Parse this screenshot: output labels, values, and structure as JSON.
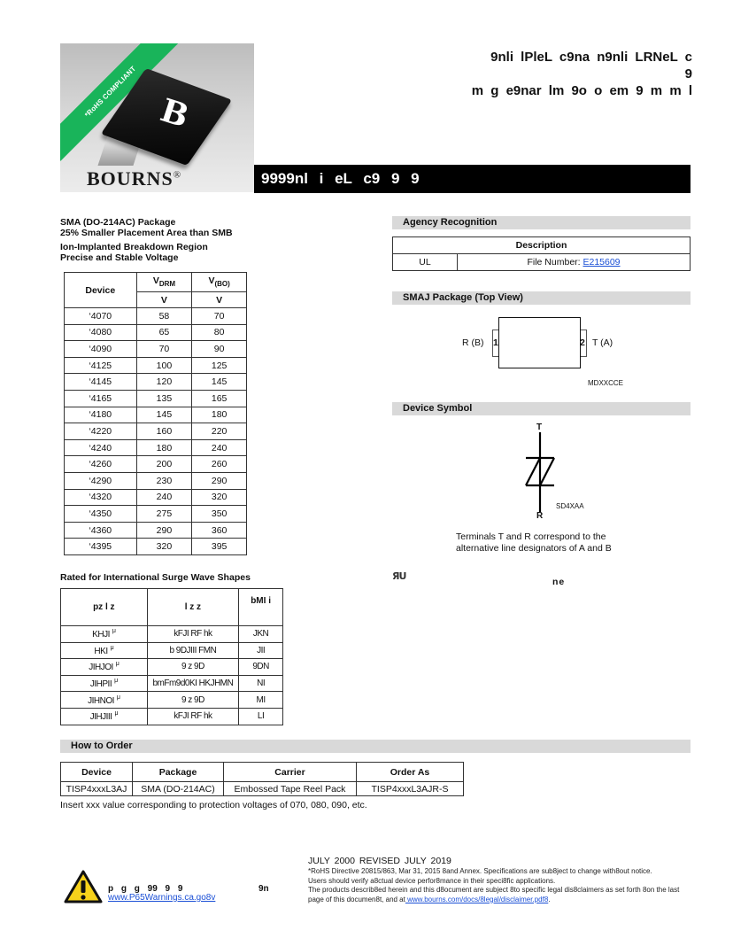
{
  "header": {
    "rohs_banner": "*RoHS COMPLIANT",
    "brand": "BOURNS",
    "brand_mark": "®",
    "chip_logo": "B",
    "title_line1": "9nli lPleL c9na n9nli LRNeL c",
    "title_line2": "9",
    "title_line3": "m g e9nar lm 9o o em 9 m m l",
    "bar_text": "9999nl i eL c9 9 9"
  },
  "features": [
    "SMA (DO-214AC) Package",
    "25% Smaller Placement Area than SMB",
    "Ion-Implanted Breakdown Region",
    "Precise and Stable Voltage"
  ],
  "voltage_table": {
    "headers": {
      "device": "Device",
      "vdrm_main": "V",
      "vdrm_sub": "DRM",
      "vbo_main": "V",
      "vbo_sub": "(BO)",
      "unit": "V"
    },
    "rows": [
      {
        "device": "‘4070",
        "vdrm": "58",
        "vbo": "70"
      },
      {
        "device": "‘4080",
        "vdrm": "65",
        "vbo": "80"
      },
      {
        "device": "‘4090",
        "vdrm": "70",
        "vbo": "90"
      },
      {
        "device": "‘4125",
        "vdrm": "100",
        "vbo": "125"
      },
      {
        "device": "‘4145",
        "vdrm": "120",
        "vbo": "145"
      },
      {
        "device": "‘4165",
        "vdrm": "135",
        "vbo": "165"
      },
      {
        "device": "‘4180",
        "vdrm": "145",
        "vbo": "180"
      },
      {
        "device": "‘4220",
        "vdrm": "160",
        "vbo": "220"
      },
      {
        "device": "‘4240",
        "vdrm": "180",
        "vbo": "240"
      },
      {
        "device": "‘4260",
        "vdrm": "200",
        "vbo": "260"
      },
      {
        "device": "‘4290",
        "vdrm": "230",
        "vbo": "290"
      },
      {
        "device": "‘4320",
        "vdrm": "240",
        "vbo": "320"
      },
      {
        "device": "‘4350",
        "vdrm": "275",
        "vbo": "350"
      },
      {
        "device": "‘4360",
        "vdrm": "290",
        "vbo": "360"
      },
      {
        "device": "‘4395",
        "vdrm": "320",
        "vbo": "395"
      }
    ]
  },
  "surge": {
    "title": "Rated for International Surge Wave Shapes",
    "headers": [
      "pz l z",
      "l z z",
      "bMI i"
    ],
    "rows": [
      {
        "c1": "KHJI",
        "c2": "kFJI RF hk",
        "c3": "JKN"
      },
      {
        "c1": "HKI",
        "c2": "b 9DJIII FMN",
        "c3": "JII"
      },
      {
        "c1": "JIHJOI",
        "c2": "9 z 9D",
        "c3": "9DN"
      },
      {
        "c1": "JIHPII",
        "c2": "bmFm9d0KI HKJHMN",
        "c3": "NI"
      },
      {
        "c1": "JIHNOI",
        "c2": "9 z 9D",
        "c3": "MI"
      },
      {
        "c1": "JIHJIII",
        "c2": "kFJI RF hk",
        "c3": "LI"
      }
    ],
    "unit_mark": "μ"
  },
  "agency": {
    "title": "Agency Recognition",
    "header": "Description",
    "agency_name": "UL",
    "file_label": "File Number: ",
    "file_number": "E215609"
  },
  "package": {
    "title": "SMAJ Package (Top View)",
    "pin1": "1",
    "pin2": "2",
    "left_label": "R (B)",
    "right_label": "T (A)",
    "code": "MDXXCCE"
  },
  "symbol": {
    "title": "Device Symbol",
    "top_terminal": "T",
    "bottom_terminal": "R",
    "code": "SD4XAA",
    "note_line1": "Terminals T and R correspond to the",
    "note_line2": "alternative line designators of A and B"
  },
  "ul_mark": "ЯU",
  "ne_text": "ne",
  "order": {
    "title": "How to Order",
    "headers": [
      "Device",
      "Package",
      "Carrier",
      "Order As"
    ],
    "row": [
      "TISP4xxxL3AJ",
      "SMA (DO-214AC)",
      "Embossed Tape Reel Pack",
      "TISP4xxxL3AJR-S"
    ],
    "note": "Insert xxx value corresponding to protection voltages of 070, 080, 090, etc."
  },
  "footer": {
    "date": "JULY 2000    REVISED JULY 2019",
    "legal1": "*RoHS Directive 20815/863, Mar 31, 2015 8and Annex. Specifications are sub8ject to change with8out notice.",
    "legal2": "Users should verify a8ctual device perfor8mance in their speci8fic applications.",
    "legal3": "The products describ8ed herein and this d8ocument are subject 8to specific legal dis8claimers as set forth 8on the last",
    "legal4_prefix": "page of this documen8t, and at",
    "legal4_link": " www.bourns.com/docs/8legal/disclaimer.pdf8",
    "legal4_suffix": ".",
    "warning_text": "p g g 99 9 9",
    "warning_text2": "9n",
    "warning_link": "www.P65Warnings.ca.go8v"
  }
}
